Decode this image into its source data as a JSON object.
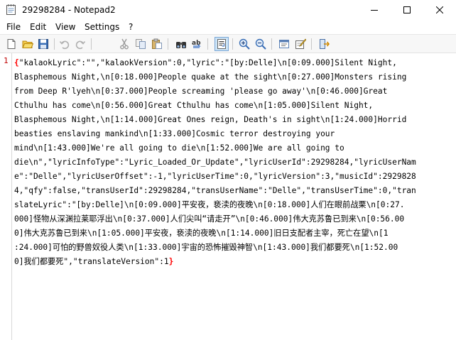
{
  "window": {
    "title": "29298284 - Notepad2",
    "app_icon": "notepad-icon",
    "controls": [
      "minimize-icon",
      "maximize-icon",
      "close-icon"
    ]
  },
  "menu": {
    "items": [
      "File",
      "Edit",
      "View",
      "Settings",
      "?"
    ]
  },
  "toolbar": {
    "buttons": [
      "new-file-icon",
      "open-file-icon",
      "save-icon",
      "undo-icon",
      "redo-icon",
      "cut-icon",
      "copy-icon",
      "paste-icon",
      "find-icon",
      "replace-icon",
      "word-wrap-icon",
      "zoom-in-icon",
      "zoom-out-icon",
      "scheme-icon",
      "customize-icon",
      "exit-icon"
    ],
    "active": "word-wrap-icon"
  },
  "editor": {
    "line_number": "1",
    "open_brace": "{",
    "close_brace": "}",
    "lines": [
      "\"kalaokLyric\":\"\",\"kalaokVersion\":0,\"lyric\":\"[by:Delle]\\n[0:09.000]Silent Night,",
      "Blasphemous Night,\\n[0:18.000]People quake at the sight\\n[0:27.000]Monsters rising",
      "from Deep R'lyeh\\n[0:37.000]People screaming 'please go away'\\n[0:46.000]Great",
      "Cthulhu has come\\n[0:56.000]Great Cthulhu has come\\n[1:05.000]Silent Night,",
      "Blasphemous Night,\\n[1:14.000]Great Ones reign, Death's in sight\\n[1:24.000]Horrid",
      "beasties enslaving mankind\\n[1:33.000]Cosmic terror destroying your",
      "mind\\n[1:43.000]We're all going to die\\n[1:52.000]We are all going to",
      "die\\n\",\"lyricInfoType\":\"Lyric_Loaded_Or_Update\",\"lyricUserId\":29298284,\"lyricUserNam",
      "e\":\"Delle\",\"lyricUserOffset\":-1,\"lyricUserTime\":0,\"lyricVersion\":3,\"musicId\":2929828",
      "4,\"qfy\":false,\"transUserId\":29298284,\"transUserName\":\"Delle\",\"transUserTime\":0,\"tran",
      "slateLyric\":\"[by:Delle]\\n[0:09.000]平安夜，亵渎的夜晚\\n[0:18.000]人们在眼前战栗\\n[0:27.",
      "000]怪物从深渊拉莱耶浮出\\n[0:37.000]人们尖叫“请走开”\\n[0:46.000]伟大克苏鲁已到来\\n[0:56.00",
      "0]伟大克苏鲁已到来\\n[1:05.000]平安夜，亵渎的夜晚\\n[1:14.000]旧日支配者主宰，死亡在望\\n[1",
      ":24.000]可怕的野兽奴役人类\\n[1:33.000]宇宙的恐怖摧毁神智\\n[1:43.000]我们都要死\\n[1:52.00",
      "0]我们都要死\",\"translateVersion\":1"
    ]
  }
}
